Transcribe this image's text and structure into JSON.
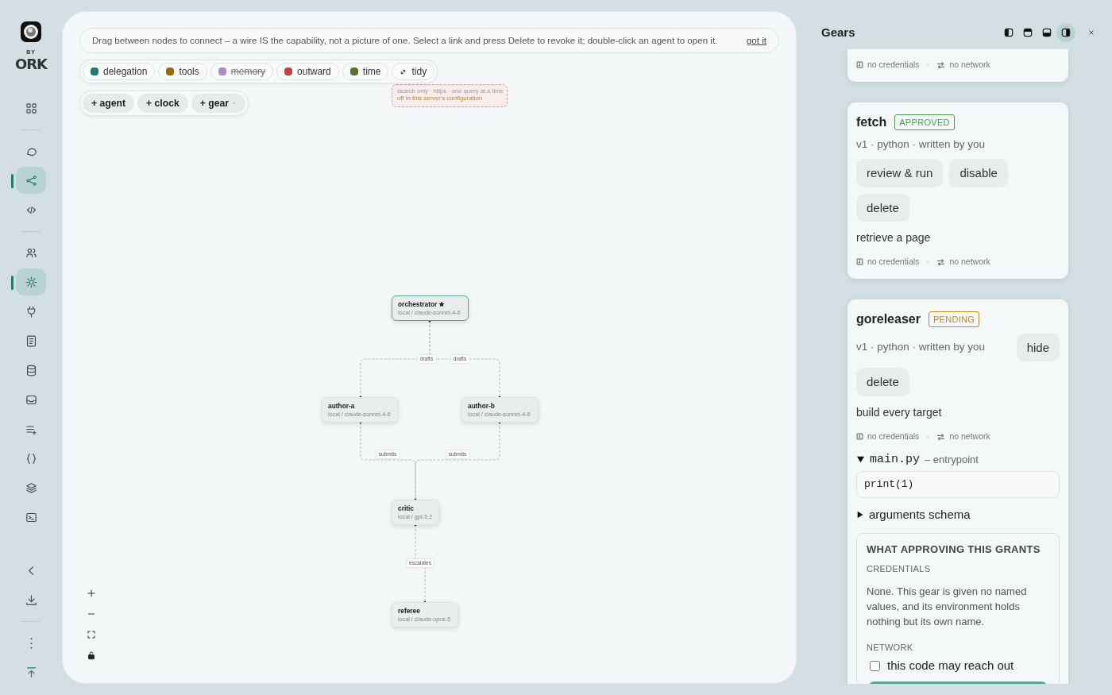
{
  "sidebar": {
    "logo_caption": "BY",
    "logo_text": "ORK",
    "groups": [
      {
        "items": [
          {
            "selected": false
          }
        ]
      },
      {
        "items": [
          {
            "selected": false
          },
          {
            "selected": true
          },
          {
            "selected": false
          }
        ]
      },
      {
        "items": [
          {
            "selected": false
          },
          {
            "selected": true
          },
          {
            "selected": false
          },
          {
            "selected": false
          },
          {
            "selected": false
          },
          {
            "selected": false
          },
          {
            "selected": false
          },
          {
            "selected": false
          },
          {
            "selected": false
          },
          {
            "selected": false
          }
        ]
      },
      {
        "items": [
          {
            "selected": false
          },
          {
            "selected": false
          }
        ]
      },
      {
        "items": [
          {
            "selected": false
          },
          {
            "selected": false
          }
        ]
      }
    ]
  },
  "canvas": {
    "hint": "Drag between nodes to connect – a wire IS the capability, not a picture of one. Select a link and press Delete to revoke it; double-click an agent to open it.",
    "hint_link": "got it",
    "filters": [
      {
        "label": "delegation",
        "color": "#1f7a70",
        "on": true
      },
      {
        "label": "tools",
        "color": "#a0640a",
        "on": true
      },
      {
        "label": "memory",
        "color": "#a58ccf",
        "on": false
      },
      {
        "label": "outward",
        "color": "#c0413f",
        "on": true
      },
      {
        "label": "time",
        "color": "#5f6f2c",
        "on": true
      }
    ],
    "tidy": "tidy",
    "add_buttons": [
      {
        "label": "+ agent",
        "menu": false
      },
      {
        "label": "+ clock",
        "menu": false
      },
      {
        "label": "+ gear",
        "menu": true
      }
    ],
    "nodes": [
      {
        "disabled": true,
        "selected": false,
        "starred": false,
        "details": "search only · https · one query at a time",
        "note": "off in this server's configuration"
      },
      {
        "title": "orchestrator",
        "model": "local / claude-sonnet-4-6",
        "disabled": false,
        "selected": true,
        "starred": true
      },
      {
        "title": "author-a",
        "model": "local / claude-sonnet-4-6",
        "disabled": false,
        "selected": false,
        "starred": false
      },
      {
        "title": "author-b",
        "model": "local / claude-sonnet-4-6",
        "disabled": false,
        "selected": false,
        "starred": false
      },
      {
        "title": "critic",
        "model": "local / gpt-5.2",
        "disabled": false,
        "selected": false,
        "starred": false
      },
      {
        "title": "referee",
        "model": "local / claude-opus-5",
        "disabled": false,
        "selected": false,
        "starred": false
      }
    ],
    "edges": [
      {
        "label": "drafts"
      },
      {
        "label": "drafts"
      },
      {
        "label": "submits"
      },
      {
        "label": "submits"
      },
      {
        "label": "escalates"
      }
    ]
  },
  "panel": {
    "title": "Gears",
    "dock_modes": [
      {
        "selected": false
      },
      {
        "selected": false
      },
      {
        "selected": false
      },
      {
        "selected": true
      }
    ],
    "gears": [
      {
        "credentials": "no credentials",
        "network": "no network"
      },
      {
        "name": "fetch",
        "status": "APPROVED",
        "kind": "approved",
        "subtitle": "v1 · python · written by you",
        "buttons": [
          "review & run",
          "disable",
          "delete"
        ],
        "description": "retrieve a page",
        "credentials": "no credentials",
        "network": "no network"
      },
      {
        "name": "goreleaser",
        "status": "PENDING",
        "kind": "pending",
        "subtitle": "v1 · python · written by you",
        "buttons": [
          "hide",
          "delete"
        ],
        "description": "build every target",
        "credentials": "no credentials",
        "network": "no network",
        "file": {
          "name": "main.py",
          "note": "– entrypoint",
          "expanded": true,
          "code": "print(1)"
        },
        "schema": {
          "label": "arguments schema",
          "expanded": false
        },
        "grants": {
          "title": "WHAT APPROVING THIS GRANTS",
          "credentials_heading": "CREDENTIALS",
          "credentials_text": "None. This gear is given no named values, and its environment holds nothing but its own name.",
          "network_heading": "NETWORK",
          "network_option": {
            "label": "this code may reach out",
            "checked": false
          }
        }
      }
    ]
  }
}
